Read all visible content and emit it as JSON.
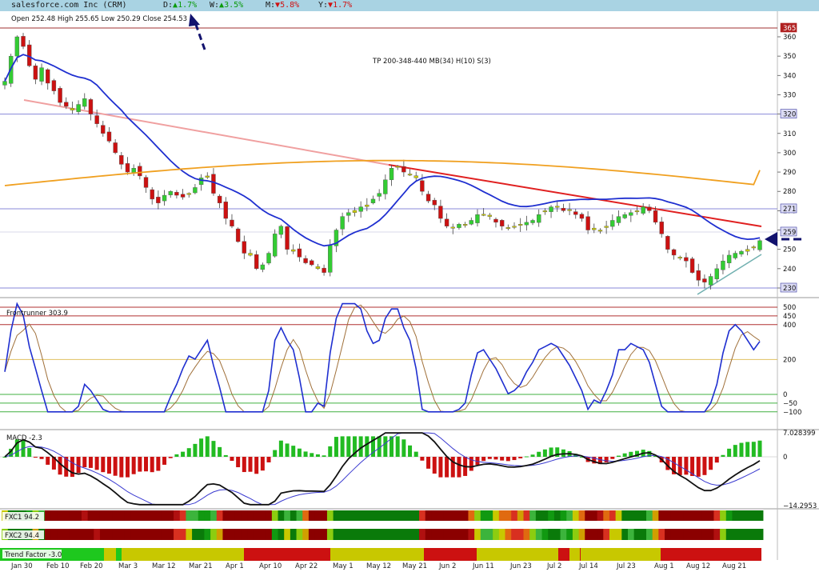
{
  "header": {
    "ticker": "salesforce.com Inc (CRM)",
    "d_label": "D:",
    "d_arrow": "▲",
    "d_val": "1.7%",
    "w_label": "W:",
    "w_arrow": "▲",
    "w_val": "3.5%",
    "m_label": "M:",
    "m_arrow": "▼",
    "m_val": "5.8%",
    "y_label": "Y:",
    "y_arrow": "▼",
    "y_val": "1.7%"
  },
  "ohlc": "Open 252.48  High 255.65  Low 250.29  Close 254.53",
  "annotation": "TP 200-348-440 MB(34) H(10) S(3)",
  "price_ticks": [
    "360",
    "350",
    "340",
    "330",
    "320",
    "310",
    "300",
    "290",
    "280",
    "270",
    "260",
    "250",
    "240",
    "230"
  ],
  "price_tags": [
    {
      "text": "365",
      "color": "#b02020"
    },
    {
      "text": "320",
      "color": "#3a3aa0"
    },
    {
      "text": "271",
      "color": "#3a3aa0"
    },
    {
      "text": "259",
      "color": "#3a3aa0"
    },
    {
      "text": "230",
      "color": "#3a3aa0"
    }
  ],
  "osc_title": "Frontrunner 303.9",
  "osc_ticks": [
    "500",
    "450",
    "400",
    "200",
    "0",
    "−50",
    "−100"
  ],
  "macd_title": "MACD -2.3",
  "macd_ticks": [
    "7.028399",
    "0",
    "−14.2953"
  ],
  "fxc1": "FXC1  94.2",
  "fxc2": "FXC2  94.4",
  "trend": "Trend Factor -3.0",
  "x_labels": [
    "Jan 30",
    "Feb 10",
    "Feb 20",
    "Mar 3",
    "Mar 12",
    "Mar 21",
    "Apr 1",
    "Apr 10",
    "Apr 22",
    "May 1",
    "May 12",
    "May 21",
    "Jun 2",
    "Jun 11",
    "Jun 23",
    "Jul 2",
    "Jul 14",
    "Jul 23",
    "Aug 1",
    "Aug 12",
    "Aug 21"
  ],
  "colors": {
    "up": "#33cc33",
    "down": "#cc1111",
    "neutral": "#cccc00",
    "ma_fast": "#1f2fd0",
    "ma_slow": "#f0a020",
    "resist": "#e02020",
    "old_trend": "#f0a0a0",
    "support": "#70b0b0"
  },
  "chart_data": {
    "type": "candlestick",
    "price_axis": {
      "min": 230,
      "max": 365,
      "ticks": [
        360,
        350,
        340,
        330,
        320,
        310,
        300,
        290,
        280,
        270,
        260,
        250,
        240,
        230
      ]
    },
    "levels": [
      365,
      320,
      271,
      230
    ],
    "close_series": [
      337,
      350,
      360,
      355,
      345,
      338,
      344,
      336,
      332,
      326,
      324,
      322,
      325,
      328,
      320,
      315,
      310,
      306,
      300,
      294,
      290,
      292,
      288,
      282,
      276,
      274,
      278,
      280,
      278,
      277,
      279,
      282,
      287,
      288,
      279,
      274,
      266,
      262,
      254,
      248,
      248,
      240,
      242,
      248,
      258,
      262,
      250,
      249,
      246,
      243,
      242,
      240,
      238,
      252,
      260,
      267,
      269,
      269,
      272,
      273,
      276,
      279,
      286,
      292,
      293,
      290,
      289,
      287,
      280,
      275,
      273,
      266,
      262,
      261,
      263,
      263,
      265,
      268,
      268,
      267,
      264,
      262,
      261,
      262,
      263,
      264,
      265,
      268,
      270,
      272,
      272,
      270,
      270,
      268,
      266,
      260,
      261,
      260,
      262,
      265,
      267,
      268,
      269,
      270,
      272,
      270,
      264,
      258,
      250,
      247,
      246,
      244,
      238,
      234,
      233,
      236,
      240,
      244,
      247,
      248,
      249,
      250,
      251,
      254.5
    ],
    "fast_ma_end": 256,
    "slow_ma_end": 291,
    "oscillator": {
      "title": "Frontrunner",
      "last": 303.9,
      "levels": [
        500,
        450,
        400,
        200,
        0,
        -50,
        -100
      ]
    },
    "macd": {
      "last": -2.3,
      "max": 7.028399,
      "min": -14.2953
    }
  }
}
